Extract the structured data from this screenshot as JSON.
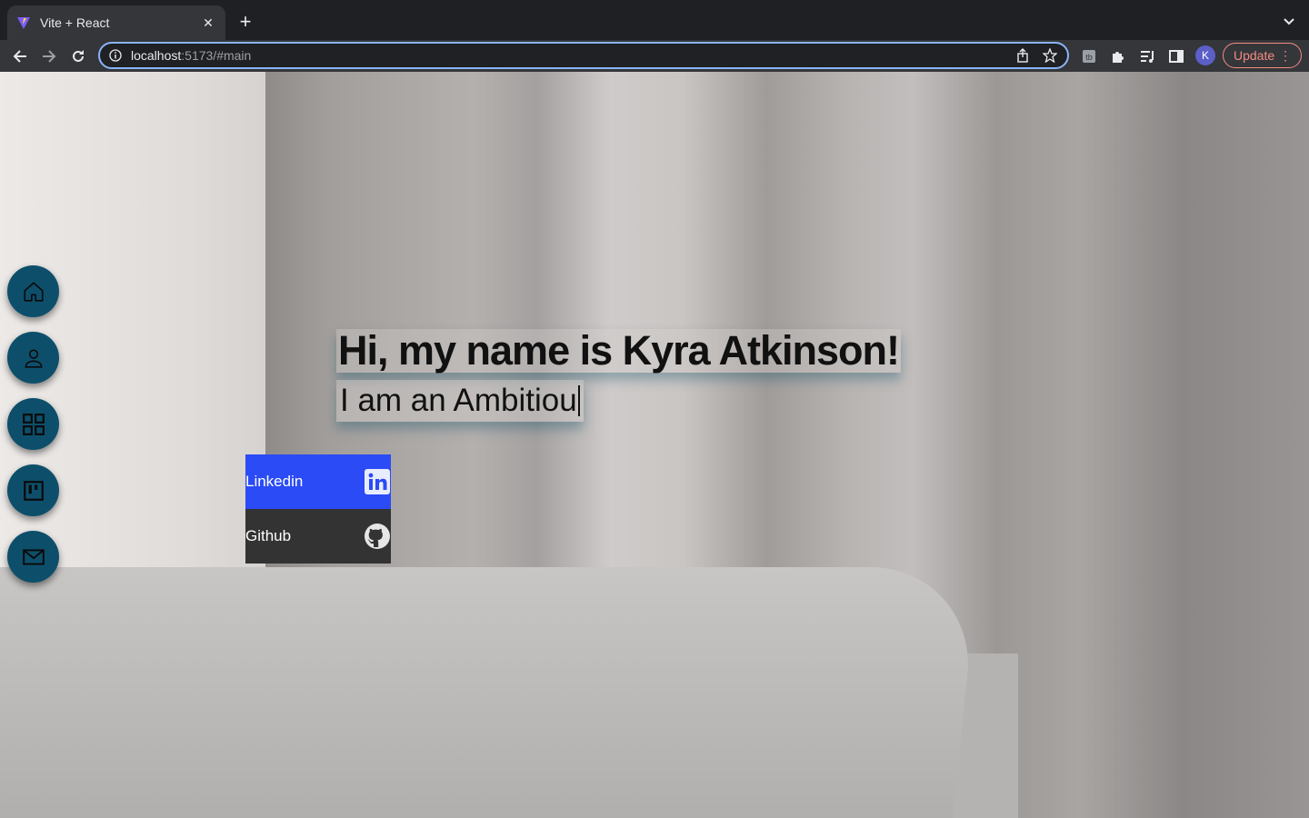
{
  "browser": {
    "tab": {
      "title": "Vite + React"
    },
    "url": {
      "host": "localhost",
      "rest": ":5173/#main"
    },
    "profile_initial": "K",
    "update_label": "Update"
  },
  "hero": {
    "title": "Hi, my name is Kyra Atkinson!",
    "subtitle_typed": "I am an Ambitiou"
  },
  "sidebar": {
    "items": [
      {
        "icon": "home-icon"
      },
      {
        "icon": "user-icon"
      },
      {
        "icon": "grid-icon"
      },
      {
        "icon": "board-icon"
      },
      {
        "icon": "mail-icon"
      }
    ]
  },
  "social": {
    "items": [
      {
        "label": "Linkedin",
        "icon": "linkedin-icon",
        "color": "#2a4bf5"
      },
      {
        "label": "Github",
        "icon": "github-icon",
        "color": "#333333"
      }
    ]
  },
  "colors": {
    "sidebar_button": "#0d4f6b",
    "linkedin": "#2a4bf5",
    "github": "#333333"
  }
}
